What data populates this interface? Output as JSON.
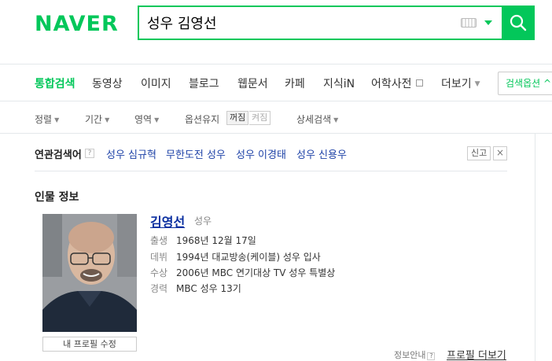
{
  "header": {
    "logo": "NAVER",
    "search": {
      "value": "성우 김영선"
    }
  },
  "tabs": [
    {
      "label": "통합검색",
      "active": true
    },
    {
      "label": "동영상"
    },
    {
      "label": "이미지"
    },
    {
      "label": "블로그"
    },
    {
      "label": "웹문서"
    },
    {
      "label": "카페"
    },
    {
      "label": "지식iN"
    },
    {
      "label": "어학사전"
    },
    {
      "label": "더보기"
    }
  ],
  "search_options_label": "검색옵션",
  "filters": {
    "sort": "정렬",
    "period": "기간",
    "area": "영역",
    "option_keep": "옵션유지",
    "toggle_off": "꺼짐",
    "toggle_on": "켜짐",
    "detail": "상세검색"
  },
  "related": {
    "title": "연관검색어",
    "help": "?",
    "items": [
      "성우 심규혁",
      "무한도전 성우",
      "성우 이경태",
      "성우 신용우"
    ],
    "report": "신고",
    "close": "×"
  },
  "person": {
    "section_title": "인물 정보",
    "name": "김영선",
    "role": "성우",
    "rows": [
      {
        "label": "출생",
        "value": "1968년 12월 17일"
      },
      {
        "label": "데뷔",
        "value": "1994년 대교방송(케이블) 성우 입사"
      },
      {
        "label": "수상",
        "value": "2006년 MBC 연기대상 TV 성우 특별상"
      },
      {
        "label": "경력",
        "value": "MBC 성우 13기"
      }
    ],
    "edit_profile": "내 프로필 수정",
    "info_guide": "정보안내",
    "more_profile": "프로필 더보기"
  },
  "colors": {
    "brand": "#03c75a",
    "link": "#2044a8"
  },
  "icons": {
    "search": "search-icon",
    "keyboard": "keyboard-icon",
    "dropdown": "chevron-down-icon"
  }
}
